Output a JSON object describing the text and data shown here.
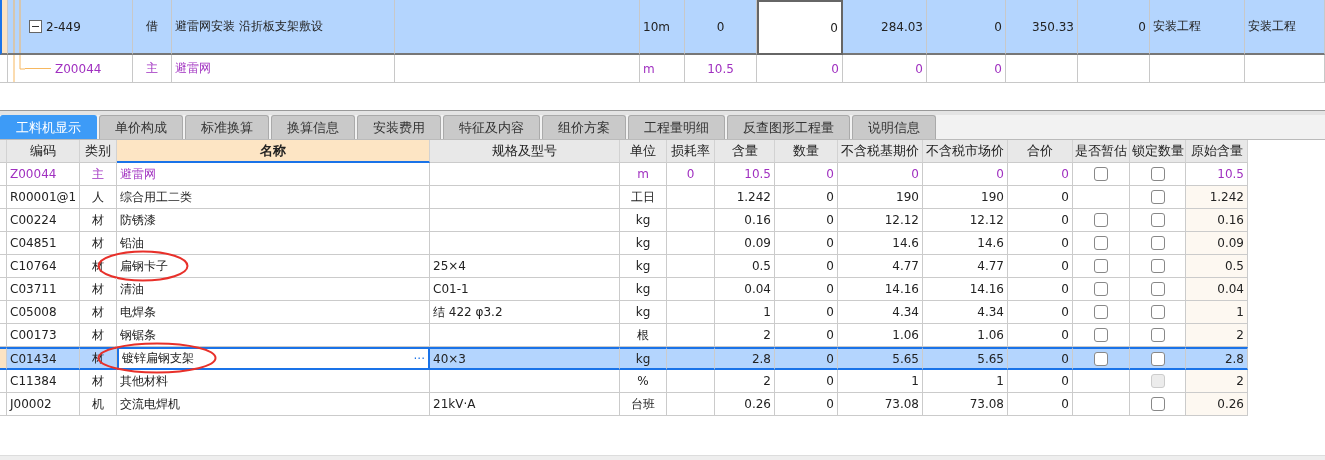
{
  "upper_table": {
    "rows": [
      {
        "code": "2-449",
        "category": "借",
        "name": "避雷网安装 沿折板支架敷设",
        "unit": "10m",
        "column_6": "0",
        "column_7": {
          "value": "0",
          "editing": true
        },
        "column_8": "284.03",
        "column_9": "0",
        "column_10": "350.33",
        "column_11": "0",
        "column_12": "安装工程",
        "column_13": "安装工程",
        "selected": true,
        "expanded": true,
        "children": [
          {
            "code": "Z00044",
            "category": "主",
            "name": "避雷网",
            "unit": "m",
            "column_6": "10.5",
            "column_7": "0",
            "column_8": "0",
            "column_9": "0",
            "selected": false,
            "kind": "main"
          }
        ]
      }
    ]
  },
  "tabs": [
    {
      "label": "工料机显示",
      "selected": true
    },
    {
      "label": "单价构成",
      "selected": false
    },
    {
      "label": "标准换算",
      "selected": false
    },
    {
      "label": "换算信息",
      "selected": false
    },
    {
      "label": "安装费用",
      "selected": false
    },
    {
      "label": "特征及内容",
      "selected": false
    },
    {
      "label": "组价方案",
      "selected": false
    },
    {
      "label": "工程量明细",
      "selected": false
    },
    {
      "label": "反查图形工程量",
      "selected": false
    },
    {
      "label": "说明信息",
      "selected": false
    }
  ],
  "resource_table": {
    "columns": [
      {
        "label": "编码",
        "selected": false
      },
      {
        "label": "类别",
        "selected": false
      },
      {
        "label": "名称",
        "selected": true
      },
      {
        "label": "规格及型号",
        "selected": false
      },
      {
        "label": "单位",
        "selected": false
      },
      {
        "label": "损耗率",
        "selected": false
      },
      {
        "label": "含量",
        "selected": false
      },
      {
        "label": "数量",
        "selected": false
      },
      {
        "label": "不含税基期价",
        "selected": false
      },
      {
        "label": "不含税市场价",
        "selected": false
      },
      {
        "label": "合价",
        "selected": false
      },
      {
        "label": "是否暂估",
        "selected": false
      },
      {
        "label": "锁定数量",
        "selected": false
      },
      {
        "label": "原始含量",
        "selected": false
      }
    ],
    "rows": [
      {
        "kind": "main",
        "code": "Z00044",
        "category": "主",
        "name": "避雷网",
        "unit": "m",
        "loss_rate": "0",
        "content": "10.5",
        "quantity": "0",
        "base_price": "0",
        "market_price": "0",
        "total": "0",
        "estimate": {
          "checked": false
        },
        "lock": {
          "checked": false,
          "disabled": false
        },
        "original": "10.5",
        "selected": false,
        "circled": false
      },
      {
        "kind": "normal",
        "code": "R00001@1",
        "category": "人",
        "name": "综合用工二类",
        "unit": "工日",
        "content": "1.242",
        "quantity": "0",
        "base_price": "190",
        "market_price": "190",
        "total": "0",
        "lock": {
          "checked": false,
          "disabled": false
        },
        "original": "1.242",
        "selected": false,
        "circled": false
      },
      {
        "kind": "normal",
        "code": "C00224",
        "category": "材",
        "name": "防锈漆",
        "unit": "kg",
        "content": "0.16",
        "quantity": "0",
        "base_price": "12.12",
        "market_price": "12.12",
        "total": "0",
        "estimate": {
          "checked": false
        },
        "lock": {
          "checked": false,
          "disabled": false
        },
        "original": "0.16",
        "selected": false,
        "circled": false
      },
      {
        "kind": "normal",
        "code": "C04851",
        "category": "材",
        "name": "铅油",
        "unit": "kg",
        "content": "0.09",
        "quantity": "0",
        "base_price": "14.6",
        "market_price": "14.6",
        "total": "0",
        "estimate": {
          "checked": false
        },
        "lock": {
          "checked": false,
          "disabled": false
        },
        "original": "0.09",
        "selected": false,
        "circled": false
      },
      {
        "kind": "normal",
        "code": "C10764",
        "category": "材",
        "name": "扁钢卡子",
        "spec": "25×4",
        "unit": "kg",
        "content": "0.5",
        "quantity": "0",
        "base_price": "4.77",
        "market_price": "4.77",
        "total": "0",
        "estimate": {
          "checked": false
        },
        "lock": {
          "checked": false,
          "disabled": false
        },
        "original": "0.5",
        "selected": false,
        "circled": true
      },
      {
        "kind": "normal",
        "code": "C03711",
        "category": "材",
        "name": "清油",
        "spec": "C01-1",
        "unit": "kg",
        "content": "0.04",
        "quantity": "0",
        "base_price": "14.16",
        "market_price": "14.16",
        "total": "0",
        "estimate": {
          "checked": false
        },
        "lock": {
          "checked": false,
          "disabled": false
        },
        "original": "0.04",
        "selected": false,
        "circled": false
      },
      {
        "kind": "normal",
        "code": "C05008",
        "category": "材",
        "name": "电焊条",
        "spec": "结 422 φ3.2",
        "unit": "kg",
        "content": "1",
        "quantity": "0",
        "base_price": "4.34",
        "market_price": "4.34",
        "total": "0",
        "estimate": {
          "checked": false
        },
        "lock": {
          "checked": false,
          "disabled": false
        },
        "original": "1",
        "selected": false,
        "circled": false
      },
      {
        "kind": "normal",
        "code": "C00173",
        "category": "材",
        "name": "钢锯条",
        "unit": "根",
        "content": "2",
        "quantity": "0",
        "base_price": "1.06",
        "market_price": "1.06",
        "total": "0",
        "estimate": {
          "checked": false
        },
        "lock": {
          "checked": false,
          "disabled": false
        },
        "original": "2",
        "selected": false,
        "circled": false
      },
      {
        "kind": "normal",
        "code": "C01434",
        "category": "材",
        "name": "镀锌扁钢支架",
        "name_button": "···",
        "spec": "40×3",
        "unit": "kg",
        "content": "2.8",
        "quantity": "0",
        "base_price": "5.65",
        "market_price": "5.65",
        "total": "0",
        "estimate": {
          "checked": false
        },
        "lock": {
          "checked": false,
          "disabled": false
        },
        "original": "2.8",
        "selected": true,
        "circled": true
      },
      {
        "kind": "normal",
        "code": "C11384",
        "category": "材",
        "name": "其他材料",
        "unit": "%",
        "content": "2",
        "quantity": "0",
        "base_price": "1",
        "market_price": "1",
        "total": "0",
        "lock": {
          "checked": false,
          "disabled": true
        },
        "original": "2",
        "selected": false,
        "circled": false
      },
      {
        "kind": "normal",
        "code": "J00002",
        "category": "机",
        "name": "交流电焊机",
        "spec": "21kV·A",
        "unit": "台班",
        "content": "0.26",
        "quantity": "0",
        "base_price": "73.08",
        "market_price": "73.08",
        "total": "0",
        "lock": {
          "checked": false,
          "disabled": false
        },
        "original": "0.26",
        "selected": false,
        "circled": false
      }
    ]
  }
}
